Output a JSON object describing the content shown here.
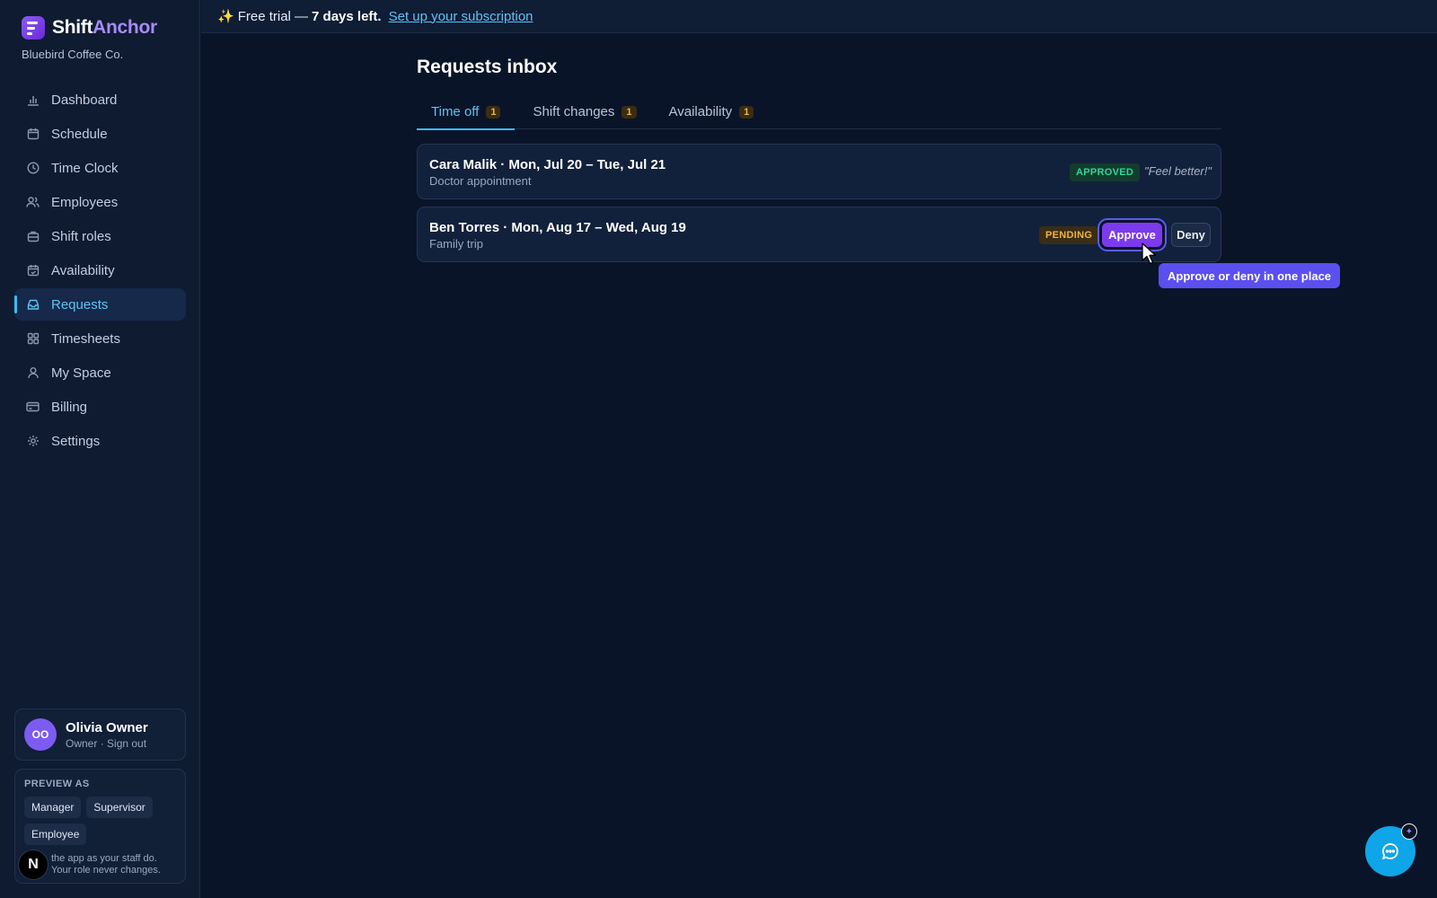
{
  "brand": {
    "name_part1": "Shift",
    "name_part2": "Anchor",
    "company": "Bluebird Coffee Co."
  },
  "banner": {
    "spark": "✨",
    "prefix": "Free trial —",
    "days": "7 days left.",
    "link": "Set up your subscription"
  },
  "sidebar": {
    "items": [
      {
        "label": "Dashboard",
        "icon": "bar-chart-icon"
      },
      {
        "label": "Schedule",
        "icon": "calendar-icon"
      },
      {
        "label": "Time Clock",
        "icon": "clock-icon"
      },
      {
        "label": "Employees",
        "icon": "users-icon"
      },
      {
        "label": "Shift roles",
        "icon": "briefcase-icon"
      },
      {
        "label": "Availability",
        "icon": "calendar-check-icon"
      },
      {
        "label": "Requests",
        "icon": "inbox-icon",
        "active": true
      },
      {
        "label": "Timesheets",
        "icon": "grid-icon"
      },
      {
        "label": "My Space",
        "icon": "user-icon"
      },
      {
        "label": "Billing",
        "icon": "credit-card-icon"
      },
      {
        "label": "Settings",
        "icon": "gear-icon"
      }
    ]
  },
  "user": {
    "initials": "OO",
    "name": "Olivia Owner",
    "role": "Owner",
    "separator": "·",
    "signout": "Sign out"
  },
  "preview": {
    "title": "PREVIEW AS",
    "options": [
      "Manager",
      "Supervisor",
      "Employee"
    ],
    "note": "the app as your staff do. Your role never changes."
  },
  "n_badge": "N",
  "main": {
    "title": "Requests inbox",
    "tabs": [
      {
        "label": "Time off",
        "count": "1",
        "active": true
      },
      {
        "label": "Shift changes",
        "count": "1"
      },
      {
        "label": "Availability",
        "count": "1"
      }
    ],
    "requests": [
      {
        "title": "Cara Malik · Mon, Jul 20 – Tue, Jul 21",
        "reason": "Doctor appointment",
        "status": "APPROVED",
        "note": "\"Feel better!\""
      },
      {
        "title": "Ben Torres · Mon, Aug 17 – Wed, Aug 19",
        "reason": "Family trip",
        "status": "PENDING",
        "approve": "Approve",
        "deny": "Deny"
      }
    ],
    "tooltip": "Approve or deny in one place"
  },
  "colors": {
    "accent": "#38bdf8",
    "brand": "#8b5cf6",
    "approve": "#7c3aed",
    "pending": "#f0b440",
    "approved": "#34d399"
  }
}
